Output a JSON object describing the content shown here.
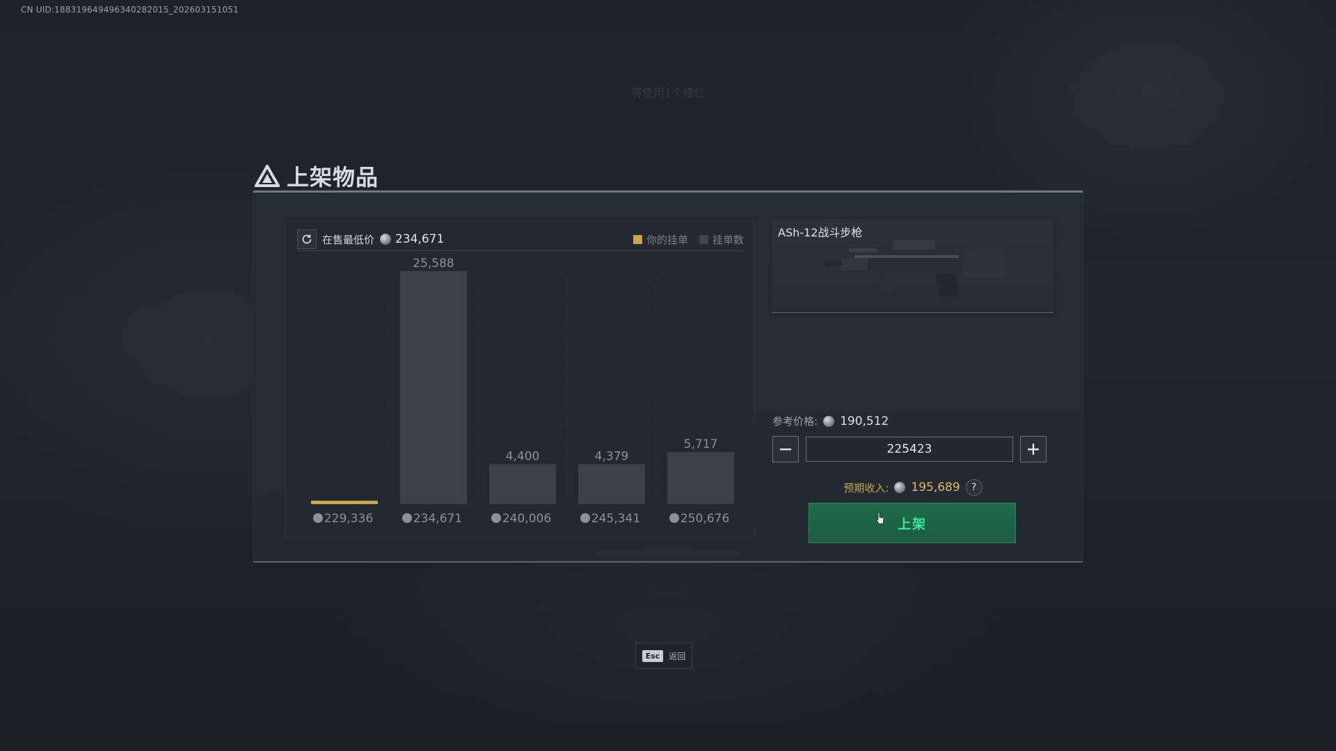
{
  "uid": "CN UID:1883196494963402820​15_202603151051",
  "top_hint": "将使用1个槽位",
  "panel": {
    "title": "上架物品"
  },
  "market": {
    "lowest_label": "在售最低价",
    "lowest_price": "234,671",
    "legend": [
      {
        "label": "你的挂单",
        "color": "#c9a64e"
      },
      {
        "label": "挂单数",
        "color": "#3f464d"
      }
    ]
  },
  "chart_data": {
    "type": "bar",
    "categories": [
      "229,336",
      "234,671",
      "240,006",
      "245,341",
      "250,676"
    ],
    "series": [
      {
        "name": "挂单数",
        "values": [
          0,
          25588,
          4400,
          4379,
          5717
        ]
      }
    ],
    "bar_labels": [
      "",
      "25,588",
      "4,400",
      "4,379",
      "5,717"
    ],
    "your_listing_index": 0,
    "ylim": [
      0,
      25588
    ],
    "grid": false,
    "legend_position": "top-right",
    "colors": {
      "listing": "#3a4148",
      "your_listing": "#c9a64e"
    }
  },
  "item": {
    "name": "ASh-12战斗步枪"
  },
  "pricing": {
    "ref_label": "参考价格:",
    "ref_value": "190,512",
    "input_value": "225423",
    "minus_icon": "minus-icon",
    "plus_icon": "plus-icon",
    "expected_label": "预期收入:",
    "expected_value": "195,689",
    "help": "?",
    "list_button": "上架"
  },
  "footer": {
    "esc_key": "Esc",
    "esc_label": "返回"
  }
}
